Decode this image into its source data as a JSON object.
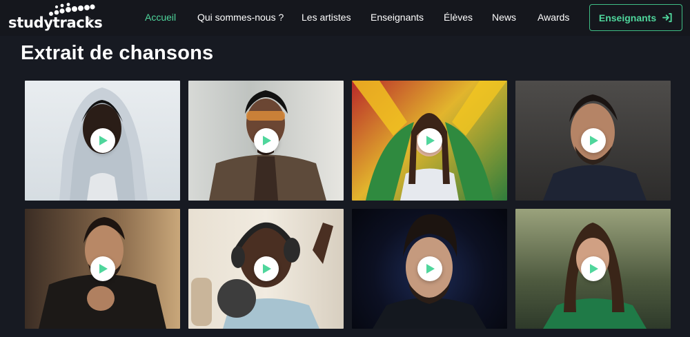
{
  "brand": {
    "name": "studytracks",
    "registered": "®"
  },
  "nav": {
    "items": [
      {
        "label": "Accueil",
        "active": true
      },
      {
        "label": "Qui sommes-nous ?",
        "active": false
      },
      {
        "label": "Les artistes",
        "active": false
      },
      {
        "label": "Enseignants",
        "active": false
      },
      {
        "label": "Élèves",
        "active": false
      },
      {
        "label": "News",
        "active": false
      },
      {
        "label": "Awards",
        "active": false
      }
    ],
    "cta_label": "Enseignants",
    "cta_icon": "sign-in-icon"
  },
  "section": {
    "title": "Extrait de chansons"
  },
  "cards": [
    {
      "name": "artist-1",
      "icon": "play-icon"
    },
    {
      "name": "artist-2",
      "icon": "play-icon"
    },
    {
      "name": "artist-3",
      "icon": "play-icon"
    },
    {
      "name": "artist-4",
      "icon": "play-icon"
    },
    {
      "name": "artist-5",
      "icon": "play-icon"
    },
    {
      "name": "artist-6",
      "icon": "play-icon"
    },
    {
      "name": "artist-7",
      "icon": "play-icon"
    },
    {
      "name": "artist-8",
      "icon": "play-icon"
    }
  ],
  "colors": {
    "accent": "#4fd69c",
    "background": "#171a22",
    "navbar": "#15171d",
    "play_button": "#ffffff"
  }
}
